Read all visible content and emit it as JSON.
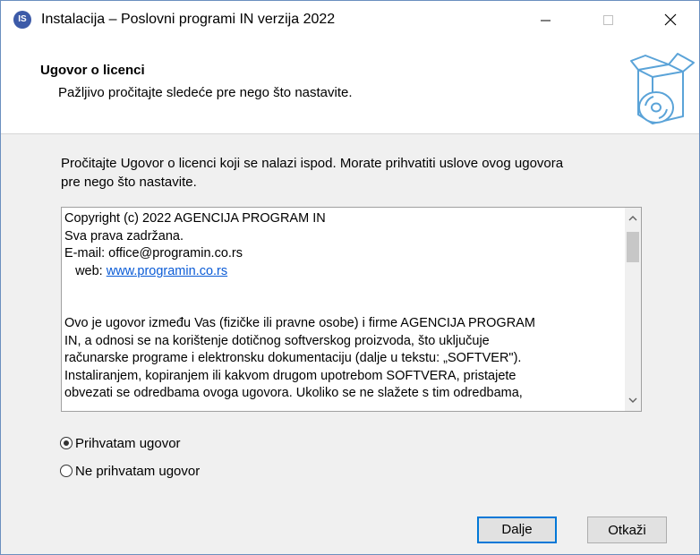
{
  "window": {
    "title": "Instalacija – Poslovni programi IN verzija 2022",
    "app_icon_text": "IS"
  },
  "header": {
    "title": "Ugovor o licenci",
    "subtitle": "Pažljivo pročitajte sledeće pre nego što nastavite."
  },
  "content": {
    "intro_line1": "Pročitajte Ugovor o licenci koji se nalazi ispod. Morate prihvatiti uslove ovog ugovora",
    "intro_line2": "pre nego što nastavite.",
    "license": {
      "line1": "Copyright (c) 2022 AGENCIJA PROGRAM IN",
      "line2": "Sva prava zadržana.",
      "line3": "E-mail: office@programin.co.rs",
      "web_label": "   web: ",
      "web_link": "www.programin.co.rs",
      "p1": "Ovo je ugovor između Vas (fizičke ili pravne osobe) i firme AGENCIJA PROGRAM",
      "p2": "IN, a odnosi se na korištenje dotičnog softverskog proizvoda, što uključuje",
      "p3": "računarske programe i elektronsku dokumentaciju (dalje u tekstu: „SOFTVER\").",
      "p4": "Instaliranjem, kopiranjem ili kakvom drugom upotrebom SOFTVERA, pristajete",
      "p5": "obvezati se odredbama ovoga ugovora. Ukoliko se ne slažete s tim odredbama,"
    },
    "accept_label": "Prihvatam ugovor",
    "decline_label": "Ne prihvatam ugovor",
    "accept_selected": true
  },
  "buttons": {
    "next": "Dalje",
    "cancel": "Otkaži"
  },
  "colors": {
    "link": "#0a5bd6",
    "focus": "#0078d7"
  }
}
